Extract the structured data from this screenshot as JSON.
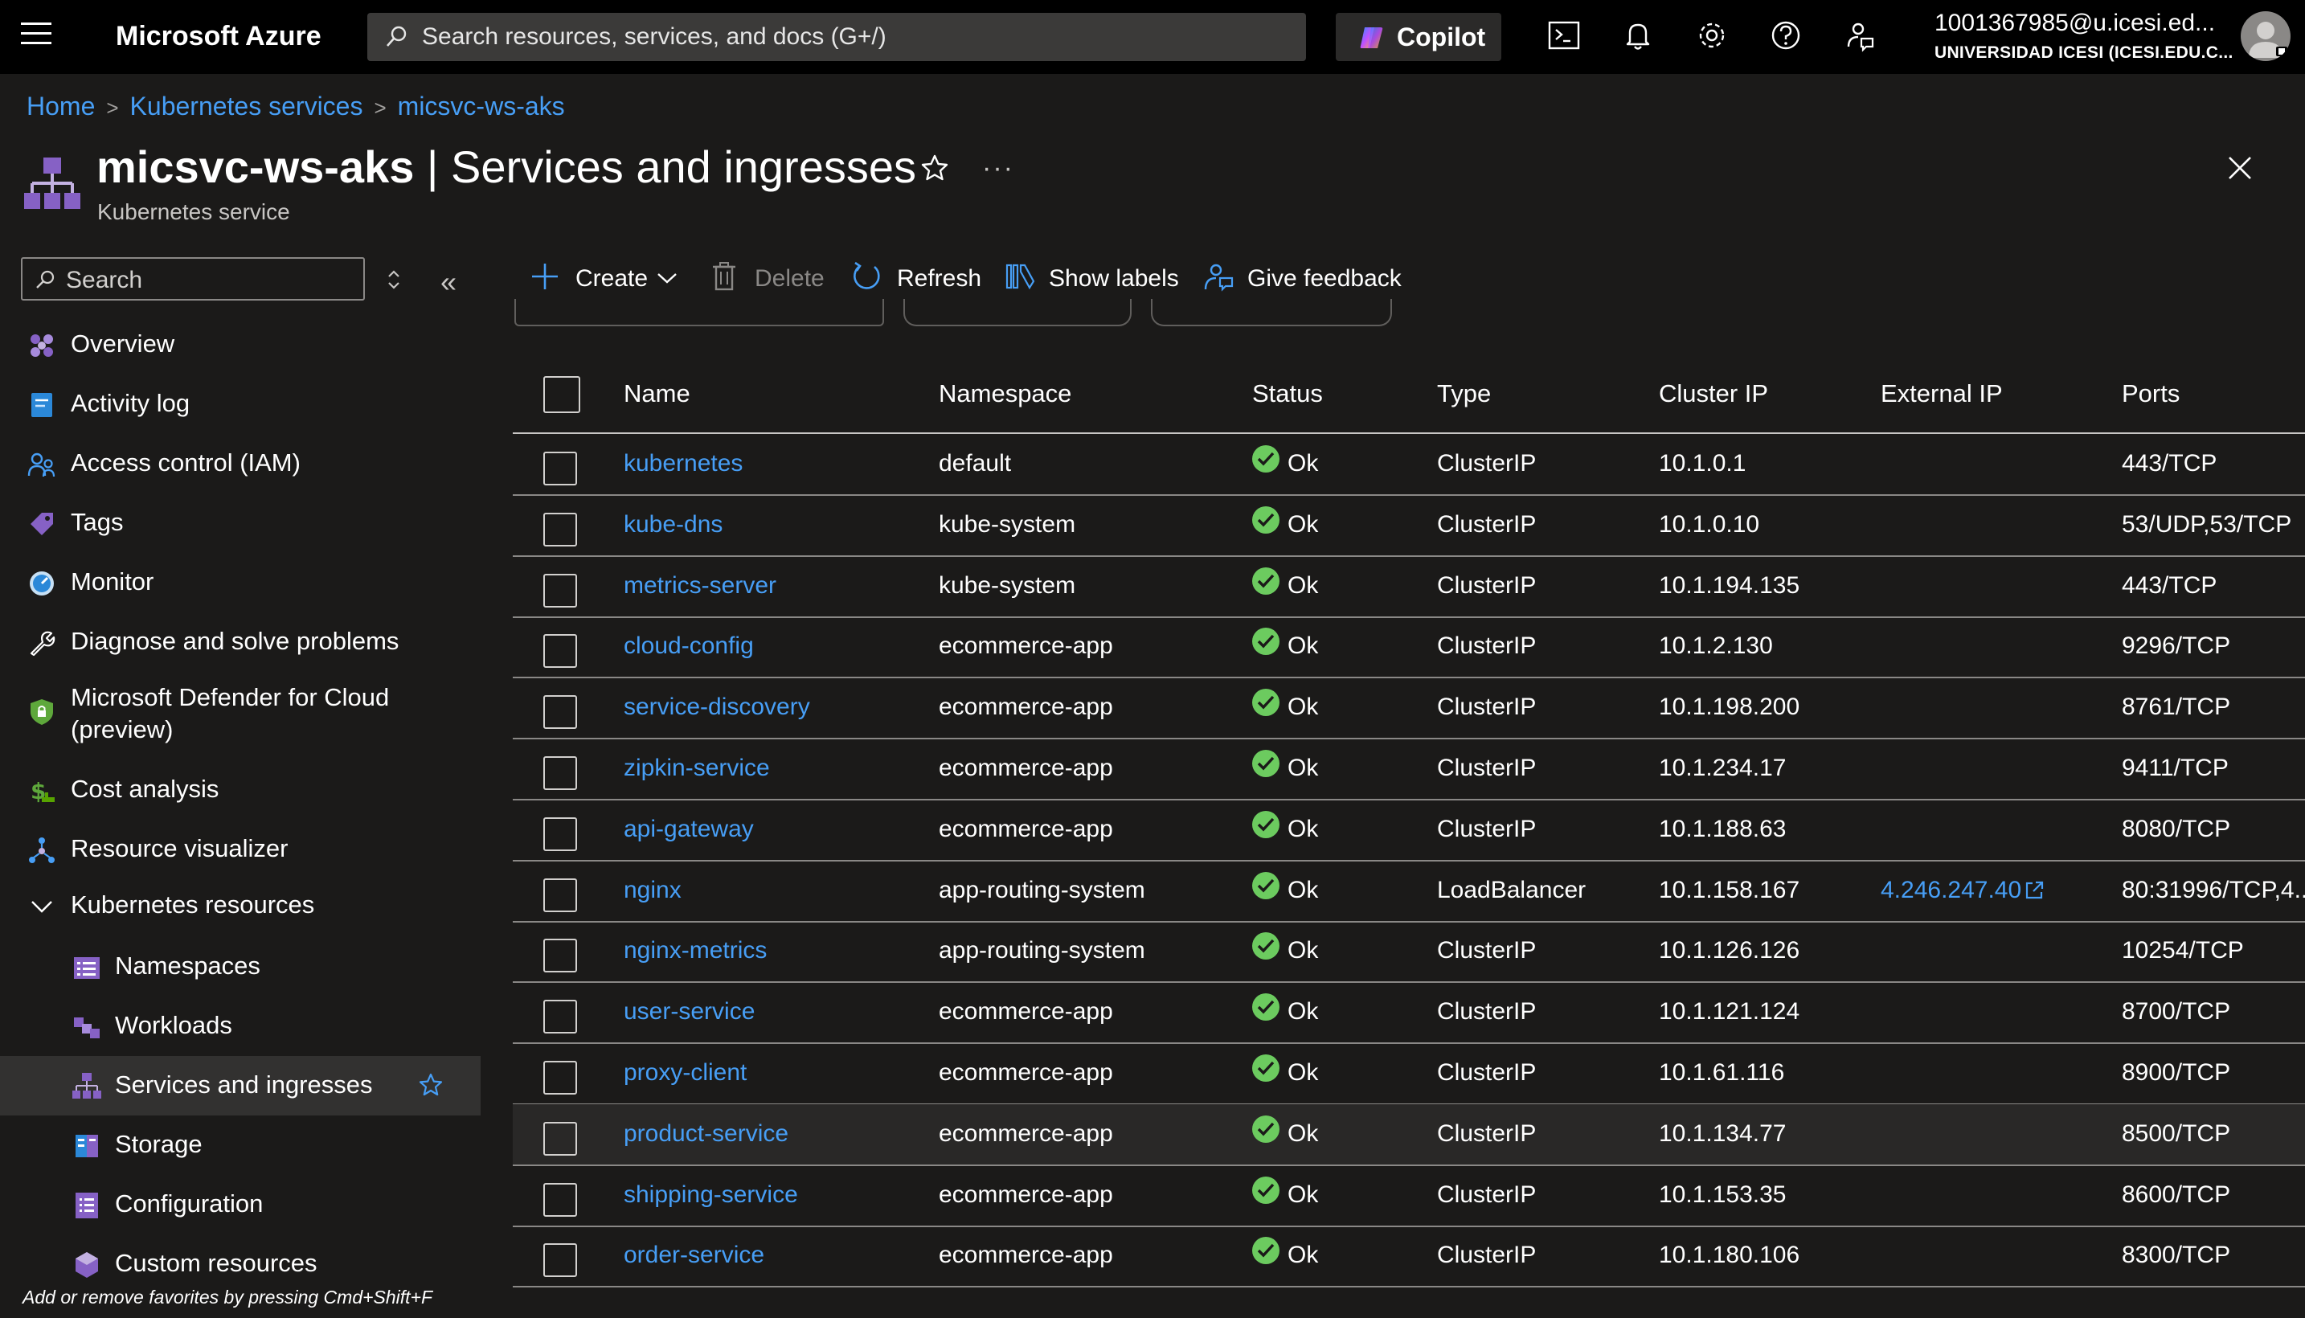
{
  "topbar": {
    "brand": "Microsoft Azure",
    "search_placeholder": "Search resources, services, and docs (G+/)",
    "copilot_label": "Copilot",
    "account_email": "1001367985@u.icesi.ed...",
    "account_org": "UNIVERSIDAD ICESI (ICESI.EDU.C..."
  },
  "breadcrumb": [
    "Home",
    "Kubernetes services",
    "micsvc-ws-aks"
  ],
  "header": {
    "resource_name": "micsvc-ws-aks",
    "separator": " | ",
    "page_name": "Services and ingresses",
    "subtitle": "Kubernetes service"
  },
  "sidebar": {
    "search_placeholder": "Search",
    "items": [
      {
        "label": "Overview",
        "icon": "overview-icon"
      },
      {
        "label": "Activity log",
        "icon": "activity-log-icon"
      },
      {
        "label": "Access control (IAM)",
        "icon": "iam-icon"
      },
      {
        "label": "Tags",
        "icon": "tag-icon"
      },
      {
        "label": "Monitor",
        "icon": "monitor-icon"
      },
      {
        "label": "Diagnose and solve problems",
        "icon": "wrench-icon"
      },
      {
        "label": "Microsoft Defender for Cloud",
        "label2": "(preview)",
        "icon": "shield-icon"
      },
      {
        "label": "Cost analysis",
        "icon": "cost-icon"
      },
      {
        "label": "Resource visualizer",
        "icon": "visualizer-icon"
      },
      {
        "label": "Kubernetes resources",
        "icon": "chevron-down-icon"
      }
    ],
    "sub_items": [
      {
        "label": "Namespaces",
        "icon": "namespaces-icon"
      },
      {
        "label": "Workloads",
        "icon": "workloads-icon"
      },
      {
        "label": "Services and ingresses",
        "icon": "services-icon",
        "selected": true
      },
      {
        "label": "Storage",
        "icon": "storage-icon"
      },
      {
        "label": "Configuration",
        "icon": "configuration-icon"
      },
      {
        "label": "Custom resources",
        "icon": "custom-resources-icon"
      }
    ],
    "favorites_hint": "Add or remove favorites by pressing Cmd+Shift+F"
  },
  "toolbar": {
    "create": "Create",
    "delete": "Delete",
    "refresh": "Refresh",
    "show_labels": "Show labels",
    "give_feedback": "Give feedback"
  },
  "table": {
    "columns": [
      "Name",
      "Namespace",
      "Status",
      "Type",
      "Cluster IP",
      "External IP",
      "Ports"
    ],
    "rows": [
      {
        "name": "kubernetes",
        "namespace": "default",
        "status": "Ok",
        "type": "ClusterIP",
        "cluster_ip": "10.1.0.1",
        "external_ip": "",
        "ports": "443/TCP"
      },
      {
        "name": "kube-dns",
        "namespace": "kube-system",
        "status": "Ok",
        "type": "ClusterIP",
        "cluster_ip": "10.1.0.10",
        "external_ip": "",
        "ports": "53/UDP,53/TCP"
      },
      {
        "name": "metrics-server",
        "namespace": "kube-system",
        "status": "Ok",
        "type": "ClusterIP",
        "cluster_ip": "10.1.194.135",
        "external_ip": "",
        "ports": "443/TCP"
      },
      {
        "name": "cloud-config",
        "namespace": "ecommerce-app",
        "status": "Ok",
        "type": "ClusterIP",
        "cluster_ip": "10.1.2.130",
        "external_ip": "",
        "ports": "9296/TCP"
      },
      {
        "name": "service-discovery",
        "namespace": "ecommerce-app",
        "status": "Ok",
        "type": "ClusterIP",
        "cluster_ip": "10.1.198.200",
        "external_ip": "",
        "ports": "8761/TCP"
      },
      {
        "name": "zipkin-service",
        "namespace": "ecommerce-app",
        "status": "Ok",
        "type": "ClusterIP",
        "cluster_ip": "10.1.234.17",
        "external_ip": "",
        "ports": "9411/TCP"
      },
      {
        "name": "api-gateway",
        "namespace": "ecommerce-app",
        "status": "Ok",
        "type": "ClusterIP",
        "cluster_ip": "10.1.188.63",
        "external_ip": "",
        "ports": "8080/TCP"
      },
      {
        "name": "nginx",
        "namespace": "app-routing-system",
        "status": "Ok",
        "type": "LoadBalancer",
        "cluster_ip": "10.1.158.167",
        "external_ip": "4.246.247.40",
        "ports": "80:31996/TCP,4..."
      },
      {
        "name": "nginx-metrics",
        "namespace": "app-routing-system",
        "status": "Ok",
        "type": "ClusterIP",
        "cluster_ip": "10.1.126.126",
        "external_ip": "",
        "ports": "10254/TCP"
      },
      {
        "name": "user-service",
        "namespace": "ecommerce-app",
        "status": "Ok",
        "type": "ClusterIP",
        "cluster_ip": "10.1.121.124",
        "external_ip": "",
        "ports": "8700/TCP"
      },
      {
        "name": "proxy-client",
        "namespace": "ecommerce-app",
        "status": "Ok",
        "type": "ClusterIP",
        "cluster_ip": "10.1.61.116",
        "external_ip": "",
        "ports": "8900/TCP"
      },
      {
        "name": "product-service",
        "namespace": "ecommerce-app",
        "status": "Ok",
        "type": "ClusterIP",
        "cluster_ip": "10.1.134.77",
        "external_ip": "",
        "ports": "8500/TCP"
      },
      {
        "name": "shipping-service",
        "namespace": "ecommerce-app",
        "status": "Ok",
        "type": "ClusterIP",
        "cluster_ip": "10.1.153.35",
        "external_ip": "",
        "ports": "8600/TCP"
      },
      {
        "name": "order-service",
        "namespace": "ecommerce-app",
        "status": "Ok",
        "type": "ClusterIP",
        "cluster_ip": "10.1.180.106",
        "external_ip": "",
        "ports": "8300/TCP"
      }
    ]
  },
  "colors": {
    "accent_link": "#479ef5",
    "status_ok": "#6ccb5f",
    "background": "#1b1a19",
    "topbar": "#000000"
  }
}
